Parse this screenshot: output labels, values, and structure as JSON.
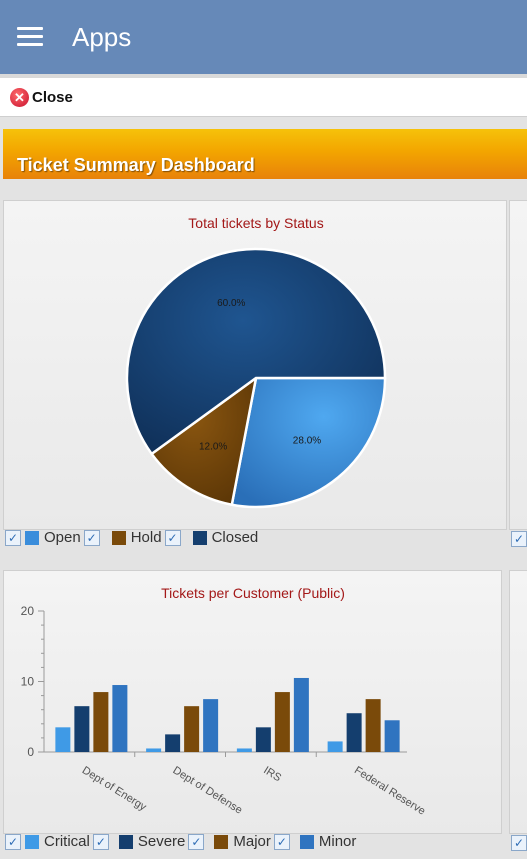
{
  "app": {
    "title": "Apps"
  },
  "toolbar": {
    "close_label": "Close",
    "close_icon": "close-circle-icon"
  },
  "dashboard": {
    "title": "Ticket Summary Dashboard"
  },
  "colors": {
    "appbar": "#6689b8",
    "header_orange": "#f3a500",
    "chart_title": "#a31818"
  },
  "chart_data": [
    {
      "type": "pie",
      "title": "Total tickets by Status",
      "slices": [
        {
          "label": "Open",
          "value": 28.0,
          "display": "28.0%",
          "color": "#3a8ddb"
        },
        {
          "label": "Hold",
          "value": 12.0,
          "display": "12.0%",
          "color": "#7a4a0a"
        },
        {
          "label": "Closed",
          "value": 60.0,
          "display": "60.0%",
          "color": "#143e6e"
        }
      ],
      "legend": [
        "Open",
        "Hold",
        "Closed"
      ],
      "legend_position": "bottom"
    },
    {
      "type": "bar",
      "title": "Tickets per Customer (Public)",
      "categories": [
        "Dept of Energy",
        "Dept of Defense",
        "IRS",
        "Federal Reserve"
      ],
      "ylim": [
        0,
        20
      ],
      "yticks": [
        "0",
        "10",
        "20"
      ],
      "series": [
        {
          "name": "Critical",
          "color": "#3f9ae6",
          "values": [
            3.5,
            0.5,
            0.5,
            1.5
          ]
        },
        {
          "name": "Severe",
          "color": "#143e6e",
          "values": [
            6.5,
            2.5,
            3.5,
            5.5
          ]
        },
        {
          "name": "Major",
          "color": "#7a4a0a",
          "values": [
            8.5,
            6.5,
            8.5,
            7.5
          ]
        },
        {
          "name": "Minor",
          "color": "#2f74c0",
          "values": [
            9.5,
            7.5,
            10.5,
            4.5
          ]
        }
      ],
      "legend_position": "bottom"
    }
  ]
}
